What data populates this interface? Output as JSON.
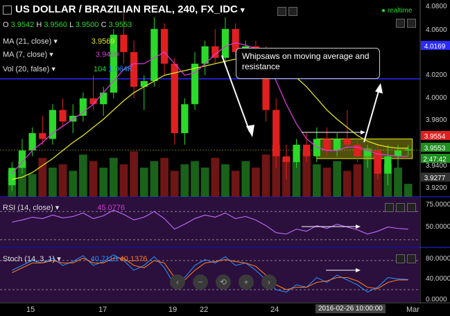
{
  "header": {
    "title": "US DOLLAR / BRAZILIAN REAL, 240, FX_IDC",
    "title_arrow": "▾",
    "realtime": "realtime",
    "ohlc": {
      "o_label": "O",
      "o": "3.9542",
      "h_label": "H",
      "h": "3.9560",
      "l_label": "L",
      "l": "3.9500",
      "c_label": "C",
      "c": "3.9553"
    },
    "ma21_label": "MA (21, close)",
    "ma21_value": "3.9569",
    "ma7_label": "MA (7, close)",
    "ma7_value": "3.9499",
    "vol_label": "Vol (20, false)",
    "vol_value1": "104",
    "vol_value2": "1.064K"
  },
  "annotation": "Whipsaws on moving average and resistance",
  "price_axis": {
    "ticks": [
      "4.0800",
      "4.0600",
      "4.0169",
      "4.0200",
      "4.0000",
      "3.9800",
      "3.9554",
      "3.9553",
      "2:47:42",
      "3.9400",
      "3.9277",
      "3.9200"
    ]
  },
  "rsi": {
    "label": "RSI (14, close)",
    "value": "45.0776",
    "ticks": [
      "75.0000",
      "50.0000"
    ]
  },
  "stoch": {
    "label": "Stoch (14, 3, 1)",
    "k": "40.7110",
    "d": "40.1376",
    "ticks": [
      "80.0000",
      "40.0000",
      "0.0000"
    ]
  },
  "x_axis": {
    "labels": [
      "15",
      "17",
      "19",
      "22",
      "24",
      "2016-02-26 10:00:00",
      "Mar"
    ]
  },
  "zoom_buttons": [
    "‹",
    "−",
    "⟲",
    "+",
    "›"
  ],
  "colors": {
    "up": "#2bd92b",
    "down": "#e02020",
    "ma21": "#e6e61e",
    "ma7": "#d83ad8",
    "resistance": "#2a2aff",
    "pane_bg": "#2b0f3d"
  },
  "chart_data": {
    "type": "candlestick",
    "title": "US DOLLAR / BRAZILIAN REAL, 240, FX_IDC",
    "ylim": [
      3.915,
      4.085
    ],
    "candles": [
      [
        3.925,
        3.945,
        3.92,
        3.94
      ],
      [
        3.94,
        3.965,
        3.935,
        3.955
      ],
      [
        3.955,
        3.975,
        3.95,
        3.97
      ],
      [
        3.97,
        3.985,
        3.96,
        3.965
      ],
      [
        3.965,
        3.995,
        3.96,
        3.99
      ],
      [
        3.99,
        4.0,
        3.975,
        3.98
      ],
      [
        3.98,
        3.995,
        3.97,
        3.985
      ],
      [
        3.985,
        4.005,
        3.98,
        4.0
      ],
      [
        4.0,
        4.02,
        3.99,
        3.995
      ],
      [
        3.995,
        4.01,
        3.985,
        4.005
      ],
      [
        4.005,
        4.06,
        4.0,
        4.055
      ],
      [
        4.055,
        4.075,
        4.03,
        4.04
      ],
      [
        4.04,
        4.05,
        4.0,
        4.01
      ],
      [
        4.01,
        4.02,
        3.99,
        4.015
      ],
      [
        4.015,
        4.07,
        4.01,
        4.06
      ],
      [
        4.06,
        4.065,
        4.02,
        4.03
      ],
      [
        4.03,
        4.035,
        3.96,
        3.97
      ],
      [
        3.97,
        4.0,
        3.96,
        3.995
      ],
      [
        3.995,
        4.04,
        3.99,
        4.03
      ],
      [
        4.03,
        4.05,
        4.02,
        4.045
      ],
      [
        4.045,
        4.06,
        4.03,
        4.035
      ],
      [
        4.035,
        4.07,
        4.03,
        4.06
      ],
      [
        4.06,
        4.065,
        4.035,
        4.04
      ],
      [
        4.04,
        4.05,
        4.02,
        4.045
      ],
      [
        4.045,
        4.05,
        4.025,
        4.03
      ],
      [
        4.03,
        4.045,
        3.98,
        3.99
      ],
      [
        3.99,
        4.0,
        3.94,
        3.95
      ],
      [
        3.95,
        3.96,
        3.93,
        3.945
      ],
      [
        3.945,
        3.965,
        3.94,
        3.96
      ],
      [
        3.96,
        3.97,
        3.945,
        3.95
      ],
      [
        3.95,
        3.975,
        3.945,
        3.965
      ],
      [
        3.965,
        3.975,
        3.95,
        3.955
      ],
      [
        3.955,
        3.97,
        3.95,
        3.965
      ],
      [
        3.965,
        3.99,
        3.955,
        3.96
      ],
      [
        3.96,
        3.965,
        3.945,
        3.95
      ],
      [
        3.95,
        3.96,
        3.94,
        3.955
      ],
      [
        3.955,
        3.96,
        3.93,
        3.935
      ],
      [
        3.935,
        3.96,
        3.925,
        3.95
      ],
      [
        3.95,
        3.96,
        3.94,
        3.955
      ],
      [
        3.955,
        3.96,
        3.95,
        3.956
      ]
    ],
    "ma21": [
      3.93,
      3.932,
      3.936,
      3.942,
      3.948,
      3.955,
      3.962,
      3.968,
      3.975,
      3.982,
      3.99,
      3.998,
      4.005,
      4.01,
      4.015,
      4.02,
      4.022,
      4.024,
      4.026,
      4.028,
      4.03,
      4.032,
      4.034,
      4.036,
      4.036,
      4.034,
      4.03,
      4.025,
      4.018,
      4.01,
      4.0,
      3.99,
      3.982,
      3.975,
      3.968,
      3.963,
      3.96,
      3.958,
      3.957,
      3.957
    ],
    "ma7": [
      3.935,
      3.945,
      3.955,
      3.962,
      3.97,
      3.976,
      3.982,
      3.988,
      3.995,
      4.005,
      4.015,
      4.025,
      4.03,
      4.03,
      4.035,
      4.04,
      4.03,
      4.02,
      4.022,
      4.03,
      4.038,
      4.045,
      4.048,
      4.046,
      4.043,
      4.035,
      4.015,
      3.995,
      3.978,
      3.965,
      3.958,
      3.955,
      3.955,
      3.958,
      3.958,
      3.955,
      3.952,
      3.951,
      3.95,
      3.95
    ],
    "resistance": 4.0169,
    "volume": [
      40,
      55,
      35,
      60,
      45,
      50,
      40,
      65,
      55,
      45,
      60,
      50,
      70,
      45,
      55,
      60,
      40,
      50,
      55,
      45,
      60,
      50,
      40,
      55,
      45,
      65,
      80,
      60,
      55,
      70,
      50,
      45,
      55,
      40,
      50,
      75,
      65,
      50,
      45,
      20
    ],
    "rsi": [
      55,
      58,
      62,
      60,
      65,
      61,
      63,
      68,
      60,
      64,
      72,
      66,
      58,
      62,
      70,
      60,
      45,
      52,
      60,
      65,
      62,
      68,
      60,
      63,
      58,
      50,
      40,
      38,
      45,
      42,
      50,
      46,
      52,
      48,
      44,
      38,
      42,
      48,
      46,
      45
    ],
    "stoch_k": [
      60,
      70,
      80,
      75,
      85,
      70,
      78,
      90,
      70,
      78,
      92,
      80,
      60,
      70,
      88,
      65,
      30,
      45,
      70,
      82,
      75,
      88,
      70,
      75,
      60,
      40,
      20,
      15,
      30,
      25,
      45,
      35,
      50,
      40,
      30,
      15,
      25,
      45,
      42,
      41
    ],
    "stoch_d": [
      55,
      65,
      75,
      75,
      80,
      75,
      75,
      85,
      75,
      75,
      85,
      85,
      70,
      65,
      80,
      75,
      45,
      40,
      60,
      75,
      78,
      82,
      78,
      75,
      68,
      50,
      30,
      20,
      25,
      25,
      35,
      38,
      45,
      45,
      38,
      25,
      22,
      35,
      40,
      40
    ]
  }
}
